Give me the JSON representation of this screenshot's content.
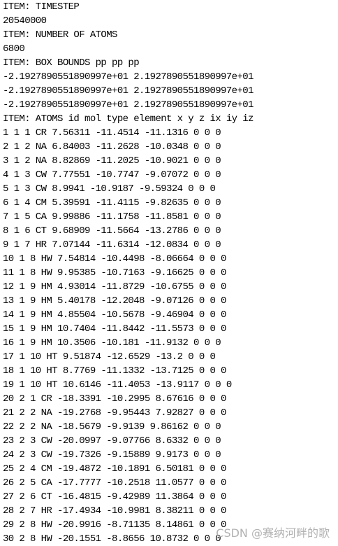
{
  "document": {
    "lines": [
      "ITEM: TIMESTEP",
      "20540000",
      "ITEM: NUMBER OF ATOMS",
      "6800",
      "ITEM: BOX BOUNDS pp pp pp",
      "-2.1927890551890997e+01 2.1927890551890997e+01",
      "-2.1927890551890997e+01 2.1927890551890997e+01",
      "-2.1927890551890997e+01 2.1927890551890997e+01",
      "ITEM: ATOMS id mol type element x y z ix iy iz",
      "1 1 1 CR 7.56311 -11.4514 -11.1316 0 0 0",
      "2 1 2 NA 6.84003 -11.2628 -10.0348 0 0 0",
      "3 1 2 NA 8.82869 -11.2025 -10.9021 0 0 0",
      "4 1 3 CW 7.77551 -10.7747 -9.07072 0 0 0",
      "5 1 3 CW 8.9941 -10.9187 -9.59324 0 0 0",
      "6 1 4 CM 5.39591 -11.4115 -9.82635 0 0 0",
      "7 1 5 CA 9.99886 -11.1758 -11.8581 0 0 0",
      "8 1 6 CT 9.68909 -11.5664 -13.2786 0 0 0",
      "9 1 7 HR 7.07144 -11.6314 -12.0834 0 0 0",
      "10 1 8 HW 7.54814 -10.4498 -8.06664 0 0 0",
      "11 1 8 HW 9.95385 -10.7163 -9.16625 0 0 0",
      "12 1 9 HM 4.93014 -11.8729 -10.6755 0 0 0",
      "13 1 9 HM 5.40178 -12.2048 -9.07126 0 0 0",
      "14 1 9 HM 4.85504 -10.5678 -9.46904 0 0 0",
      "15 1 9 HM 10.7404 -11.8442 -11.5573 0 0 0",
      "16 1 9 HM 10.3506 -10.181 -11.9132 0 0 0",
      "17 1 10 HT 9.51874 -12.6529 -13.2 0 0 0",
      "18 1 10 HT 8.7769 -11.1332 -13.7125 0 0 0",
      "19 1 10 HT 10.6146 -11.4053 -13.9117 0 0 0",
      "20 2 1 CR -18.3391 -10.2995 8.67616 0 0 0",
      "21 2 2 NA -19.2768 -9.95443 7.92827 0 0 0",
      "22 2 2 NA -18.5679 -9.9139 9.86162 0 0 0",
      "23 2 3 CW -20.0997 -9.07766 8.6332 0 0 0",
      "24 2 3 CW -19.7326 -9.15889 9.9173 0 0 0",
      "25 2 4 CM -19.4872 -10.1891 6.50181 0 0 0",
      "26 2 5 CA -17.7777 -10.2518 11.0577 0 0 0",
      "27 2 6 CT -16.4815 -9.42989 11.3864 0 0 0",
      "28 2 7 HR -17.4934 -10.9981 8.38211 0 0 0",
      "29 2 8 HW -20.9916 -8.71135 8.14861 0 0 0",
      "30 2 8 HW -20.1551 -8.8656 10.8732 0 0 0"
    ]
  },
  "watermark": {
    "text": "CSDN @赛纳河畔的歌"
  }
}
